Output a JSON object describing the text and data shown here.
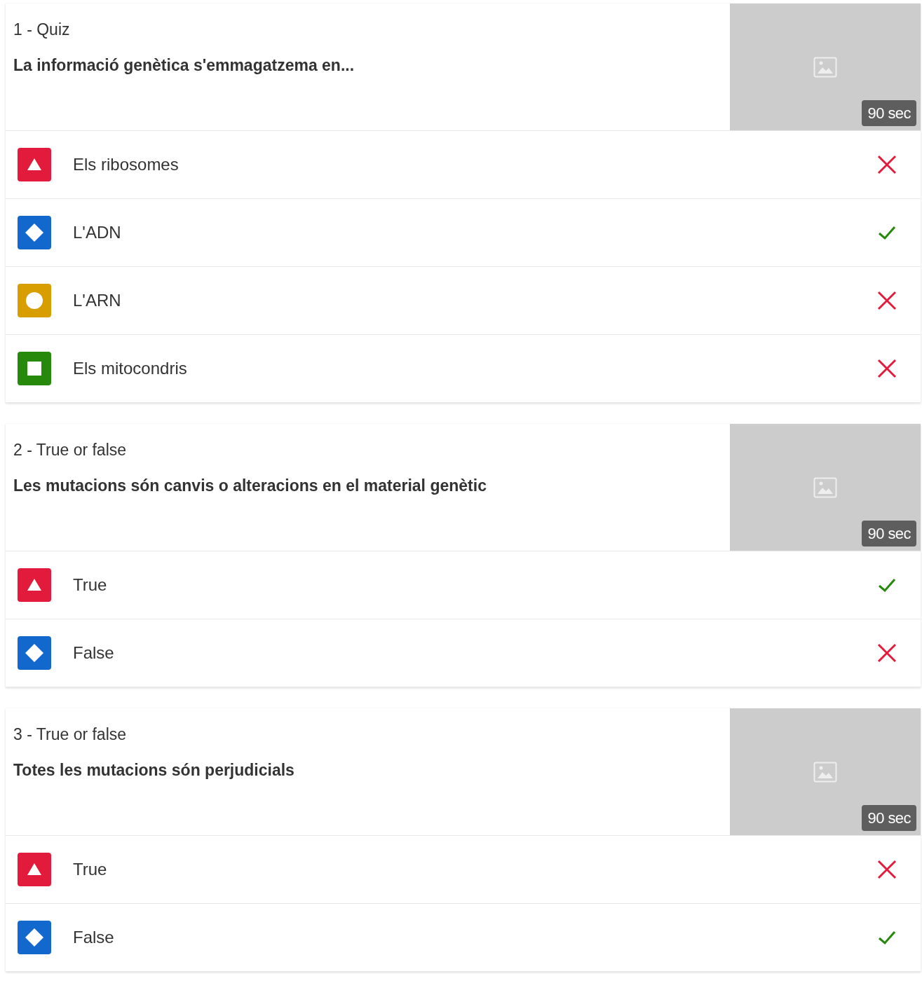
{
  "questions": [
    {
      "label": "1 - Quiz",
      "question": "La informació genètica s'emmagatzema en...",
      "time": "90 sec",
      "answers": [
        {
          "kind": "triangle",
          "text": "Els ribosomes",
          "correct": false
        },
        {
          "kind": "diamond",
          "text": "L'ADN",
          "correct": true
        },
        {
          "kind": "circle",
          "text": "L'ARN",
          "correct": false
        },
        {
          "kind": "square",
          "text": "Els mitocondris",
          "correct": false
        }
      ]
    },
    {
      "label": "2 - True or false",
      "question": "Les mutacions són canvis o alteracions en el material genètic",
      "time": "90 sec",
      "answers": [
        {
          "kind": "triangle",
          "text": "True",
          "correct": true
        },
        {
          "kind": "diamond",
          "text": "False",
          "correct": false
        }
      ]
    },
    {
      "label": "3 - True or false",
      "question": "Totes les mutacions són perjudicials",
      "time": "90 sec",
      "answers": [
        {
          "kind": "triangle",
          "text": "True",
          "correct": false
        },
        {
          "kind": "diamond",
          "text": "False",
          "correct": true
        }
      ]
    }
  ]
}
